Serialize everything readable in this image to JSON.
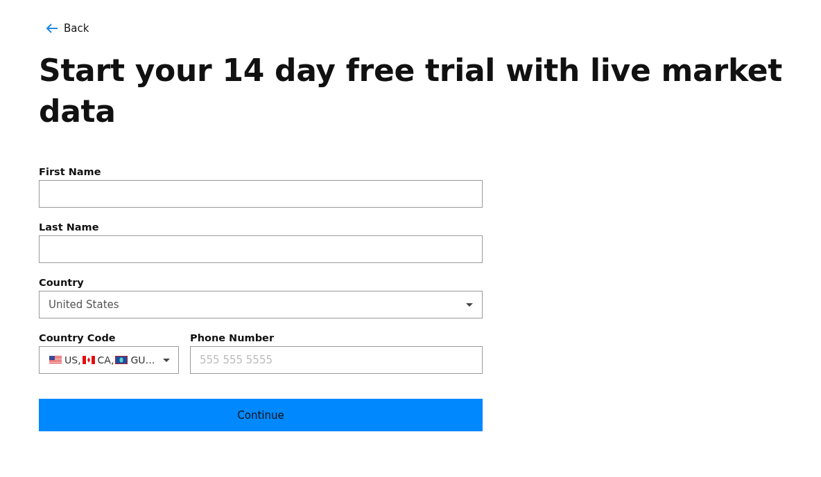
{
  "back_link": {
    "label": "Back"
  },
  "heading": "Start your 14 day free trial with live market data",
  "fields": [
    {
      "kind": "text",
      "label": "First Name"
    },
    {
      "kind": "text",
      "label": "Last Name"
    },
    {
      "kind": "select",
      "label": "Country",
      "value": "United States"
    }
  ],
  "country_code": {
    "label": "Country Code",
    "options": [
      {
        "kind": "us",
        "text": "US,"
      },
      {
        "kind": "ca",
        "text": "CA,"
      },
      {
        "kind": "gu",
        "text": "GU…"
      }
    ]
  },
  "phone": {
    "label": "Phone Number",
    "placeholder": "555 555 5555"
  },
  "continue_button": "Continue"
}
